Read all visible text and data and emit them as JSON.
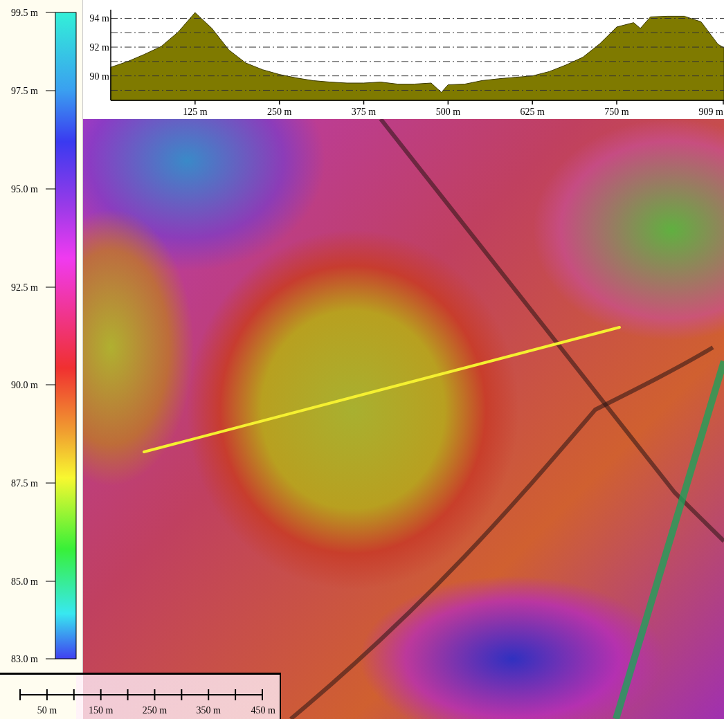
{
  "legend": {
    "ticks": [
      "99.5 m",
      "97.5 m",
      "95.0 m",
      "92.5 m",
      "90.0 m",
      "87.5 m",
      "85.0 m",
      "83.0 m"
    ]
  },
  "profile": {
    "chart_data": {
      "type": "area",
      "x": [
        0,
        25,
        50,
        75,
        100,
        125,
        150,
        175,
        200,
        225,
        250,
        275,
        300,
        325,
        350,
        375,
        400,
        425,
        450,
        475,
        490,
        500,
        525,
        550,
        575,
        600,
        625,
        650,
        675,
        700,
        725,
        750,
        775,
        785,
        800,
        825,
        850,
        875,
        900,
        909
      ],
      "series": [
        {
          "color": "#7f7a00",
          "values": [
            90.6,
            91.0,
            91.5,
            92.05,
            93.05,
            94.4,
            93.3,
            91.8,
            90.9,
            90.43,
            90.1,
            89.86,
            89.67,
            89.57,
            89.5,
            89.5,
            89.57,
            89.43,
            89.43,
            89.5,
            88.85,
            89.38,
            89.43,
            89.67,
            89.8,
            89.9,
            90.0,
            90.3,
            90.76,
            91.3,
            92.24,
            93.4,
            93.7,
            93.3,
            94.1,
            94.15,
            94.15,
            93.76,
            92.2,
            91.95
          ]
        }
      ],
      "xlim": [
        0,
        909
      ],
      "ylim": [
        88.3,
        94.6
      ],
      "grid": true,
      "xticks": [
        {
          "value": 125,
          "label": "125 m"
        },
        {
          "value": 250,
          "label": "250 m"
        },
        {
          "value": 375,
          "label": "375 m"
        },
        {
          "value": 500,
          "label": "500 m"
        },
        {
          "value": 625,
          "label": "625 m"
        },
        {
          "value": 750,
          "label": "750 m"
        },
        {
          "value": 909,
          "label": "909 m"
        }
      ],
      "yticks": [
        {
          "value": 90,
          "label": "90 m"
        },
        {
          "value": 92,
          "label": "92 m"
        },
        {
          "value": 94,
          "label": "94 m"
        }
      ]
    }
  },
  "scale_bar": {
    "labels": [
      "50 m",
      "150 m",
      "250 m",
      "350 m",
      "450 m"
    ]
  }
}
